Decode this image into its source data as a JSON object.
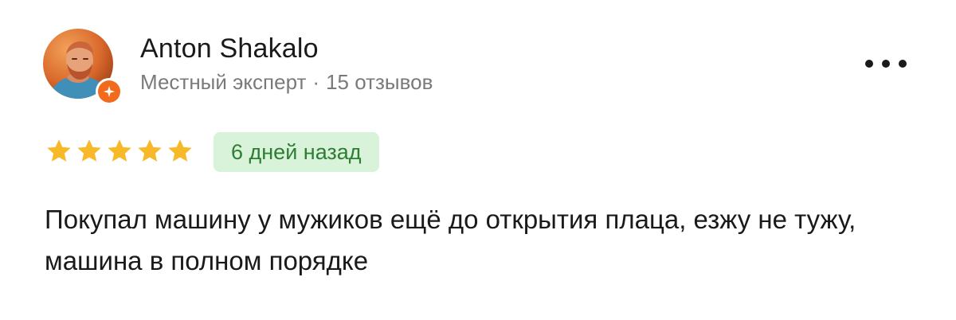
{
  "review": {
    "author": {
      "name": "Anton Shakalo",
      "level": "Местный эксперт",
      "separator": "·",
      "reviews_count": "15 отзывов",
      "avatar_icon": "user-photo-avatar",
      "badge_icon": "expert-star-badge-icon"
    },
    "rating": {
      "value": 5,
      "max": 5,
      "icon": "star-icon"
    },
    "date_label": "6 дней назад",
    "text": "Покупал машину у мужиков ещё до открытия плаца, езжу не тужу, машина в полном порядке",
    "more_icon": "more-dots-icon"
  },
  "colors": {
    "star": "#f7b928",
    "badge_orange": "#f26b1d",
    "date_bg": "#d8f3d9",
    "date_text": "#2e7d32",
    "more_dots": "#1a1a1a",
    "meta_text": "#7a7a7a"
  }
}
